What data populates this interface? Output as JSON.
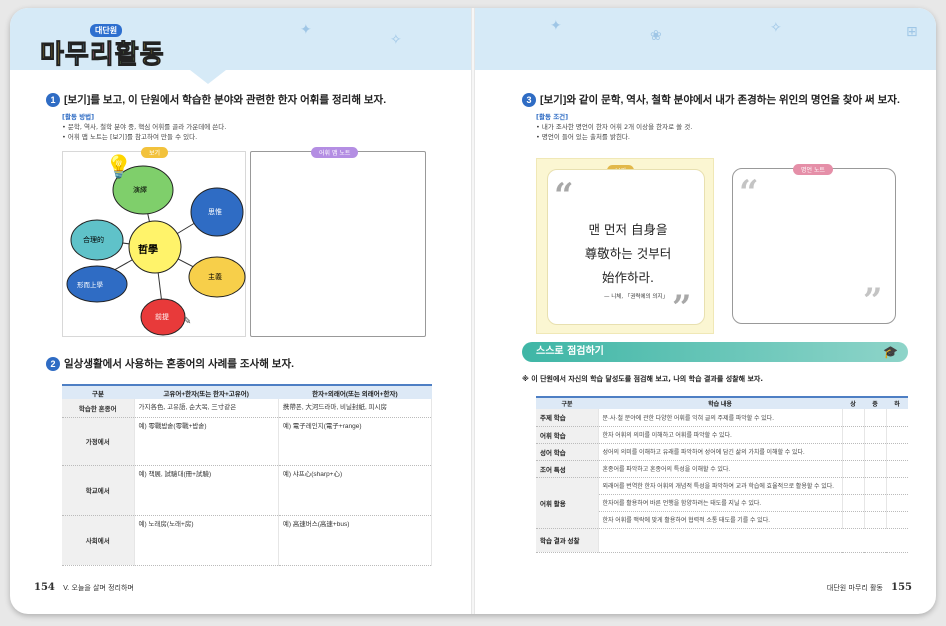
{
  "header": {
    "badge": "대단원",
    "title_chars": [
      "마",
      "무",
      "리",
      "활",
      "동"
    ]
  },
  "left": {
    "q1": {
      "num": "1",
      "text": "[보기]를 보고, 이 단원에서 학습한 분야와 관련한 한자 어휘를 정리해 보자."
    },
    "method": {
      "label": "[활동 방법]",
      "lines": [
        "• 문학, 역사, 철학 분야 중, 핵심 어휘를 골라 가운데에 쓴다.",
        "• 어휘 맵 노트는 [보기]를 참고하여 만들 수 있다."
      ]
    },
    "map": {
      "tag": "보기",
      "center": "哲學",
      "nodes": [
        "演繹",
        "思惟",
        "主義",
        "前提",
        "形而上學",
        "合理的"
      ]
    },
    "note_tag": "어휘 맵 노트",
    "q2": {
      "num": "2",
      "text": "일상생활에서 사용하는 혼종어의 사례를 조사해 보자."
    },
    "table": {
      "headers": [
        "구분",
        "고유어+한자(또는 한자+고유어)",
        "한자+외래어(또는 외래어+한자)"
      ],
      "rows": [
        {
          "label": "학습한 혼종어",
          "a": "가지各色, 고유語, 순大목, 三寸같은",
          "b": "携帶폰, 大河드라마, 비닐封紙, 피시房"
        },
        {
          "label": "가정에서",
          "a": "예) 零戰밥솥(零戰+밥솥)",
          "b": "예) 電子레인지(電子+range)"
        },
        {
          "label": "학교에서",
          "a": "예) 책展, 試驗대(冊+試驗)",
          "b": "예) 샤프心(sharp+心)"
        },
        {
          "label": "사회에서",
          "a": "예) 노래房(노래+房)",
          "b": "예) 高速버스(高速+bus)"
        }
      ]
    },
    "footer": {
      "page": "154",
      "text": "V. 오늘을 살며 정리하며"
    }
  },
  "right": {
    "q3": {
      "num": "3",
      "text": "[보기]와 같이 문학, 역사, 철학 분야에서 내가 존경하는 위인의 명언을 찾아 써 보자."
    },
    "cond": {
      "label": "[활동 조건]",
      "lines": [
        "• 내가 조사한 명언이 한자 어휘 2개 이상을 한자로 쓸 것.",
        "• 명언이 들어 있는 출처를 밝힌다."
      ]
    },
    "quote": {
      "tag": "보기",
      "lines": [
        "맨 먼저 自身을",
        "尊敬하는 것부터",
        "始作하라."
      ],
      "source": "— 니체, 「권력에의 의지」"
    },
    "quote_note_tag": "명언 노트",
    "selfcheck": {
      "title": "스스로 점검하기",
      "instr": "※  이 단원에서 자신의 학습 달성도를 점검해 보고, 나의 학습 결과를 성찰해 보자."
    },
    "table": {
      "headers": [
        "구분",
        "학습 내용",
        "상",
        "중",
        "하"
      ],
      "rows": [
        {
          "label": "주제 학습",
          "content": "문·사·철 분야에 관한 다양한 어휘를 익혀 글의 주제를 파악할 수 있다."
        },
        {
          "label": "어휘 학습",
          "content": "한자 어휘의 의미를 이해하고 어휘를 파악할 수 있다."
        },
        {
          "label": "성어 학습",
          "content": "성어의 의미를 이해하고 유래를 파악하여 성어에 담긴 삶의 가치를 이해할 수 있다."
        },
        {
          "label": "조어 특성",
          "content": "혼종어를 파악하고 혼종어의 특성을 이해할 수 있다."
        },
        {
          "label": "어휘 활용",
          "content": "외래어를 번역한 한자 어휘의 개념적 특성을 파악하여 교과 학습에 효율적으로 활용할 수 있다."
        },
        {
          "label": "",
          "content": "한자어를 활용하여 바른 언행을 함양하려는 태도를 지닐 수 있다."
        },
        {
          "label": "",
          "content": "한자 어휘를 맥락에 맞게 활용하여 협력적 소통 태도를 기를 수 있다."
        },
        {
          "label": "학습 결과 성찰",
          "content": ""
        }
      ]
    },
    "footer": {
      "page": "155",
      "text": "대단원 마무리 활동"
    }
  }
}
